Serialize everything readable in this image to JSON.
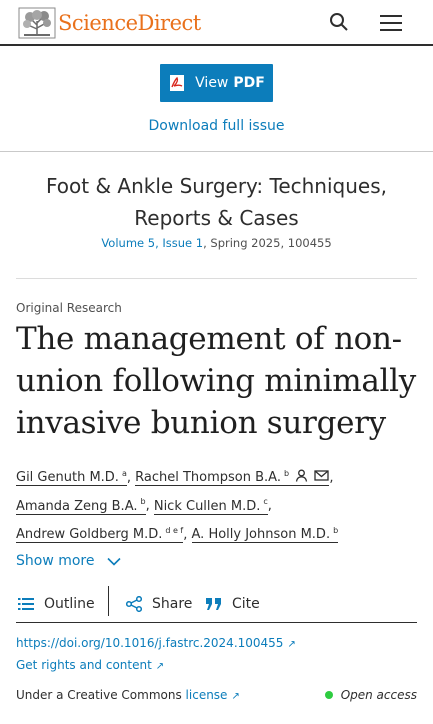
{
  "header": {
    "logo_text": "ScienceDirect",
    "brand_color": "#e9711c"
  },
  "pdf": {
    "view_label": "View",
    "pdf_label": "PDF",
    "download_label": "Download full issue",
    "button_color": "#0c7dbb"
  },
  "journal": {
    "title": "Foot & Ankle Surgery: Techniques, Reports & Cases",
    "volume_issue": "Volume 5, Issue 1",
    "rest": ", Spring 2025, 100455"
  },
  "article": {
    "type": "Original Research",
    "title": "The management of non-union following minimally invasive bunion surgery"
  },
  "authors": [
    {
      "name": "Gil Genuth M.D.",
      "sup": "a"
    },
    {
      "name": "Rachel Thompson B.A.",
      "sup": "b"
    },
    {
      "name": "Amanda Zeng B.A.",
      "sup": "b"
    },
    {
      "name": "Nick Cullen M.D.",
      "sup": "c"
    },
    {
      "name": "Andrew Goldberg M.D.",
      "sup": "d e f"
    },
    {
      "name": "A. Holly Johnson M.D.",
      "sup": "b"
    }
  ],
  "show_more": "Show more",
  "toolbar": {
    "outline": "Outline",
    "share": "Share",
    "cite": "Cite"
  },
  "links": {
    "doi": "https://doi.org/10.1016/j.fastrc.2024.100455",
    "rights": "Get rights and content",
    "cc_prefix": "Under a Creative Commons ",
    "cc_link": "license",
    "open_access": "Open access"
  },
  "icons": {
    "external": "↗"
  }
}
